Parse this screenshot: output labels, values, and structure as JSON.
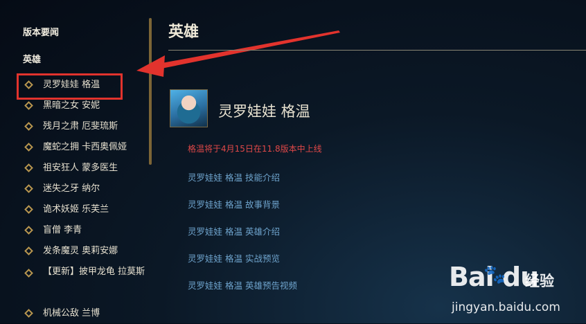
{
  "sidebar": {
    "headings": [
      "版本要闻",
      "英雄"
    ],
    "items": [
      {
        "label": "灵罗娃娃 格温"
      },
      {
        "label": "黑暗之女 安妮"
      },
      {
        "label": "残月之肃 厄斐琉斯"
      },
      {
        "label": "魔蛇之拥 卡西奥佩娅"
      },
      {
        "label": "祖安狂人 蒙多医生"
      },
      {
        "label": "迷失之牙 纳尔"
      },
      {
        "label": "诡术妖姬 乐芙兰"
      },
      {
        "label": "盲僧 李青"
      },
      {
        "label": "发条魔灵 奥莉安娜"
      },
      {
        "label": "【更新】披甲龙龟 拉莫斯"
      },
      {
        "label": "机械公敌 兰博"
      }
    ]
  },
  "main": {
    "title": "英雄",
    "champion_name": "灵罗娃娃 格温",
    "notice": "格温将于4月15日在11.8版本中上线",
    "links": [
      "灵罗娃娃 格温 技能介绍",
      "灵罗娃娃 格温 故事背景",
      "灵罗娃娃 格温 英雄介绍",
      "灵罗娃娃 格温 实战预览",
      "灵罗娃娃 格温 英雄预告视频"
    ]
  },
  "watermark": {
    "logo": "Bai  du",
    "cn": "经验",
    "url": "jingyan.baidu.com"
  },
  "colors": {
    "accent_gold": "#b8964f",
    "highlight_red": "#e2332d",
    "link_blue": "#6ea3cc",
    "notice_red": "#e04848"
  },
  "icons": [
    "diamond-bullet-icon",
    "red-arrow-annotation",
    "baidu-paw-icon"
  ]
}
